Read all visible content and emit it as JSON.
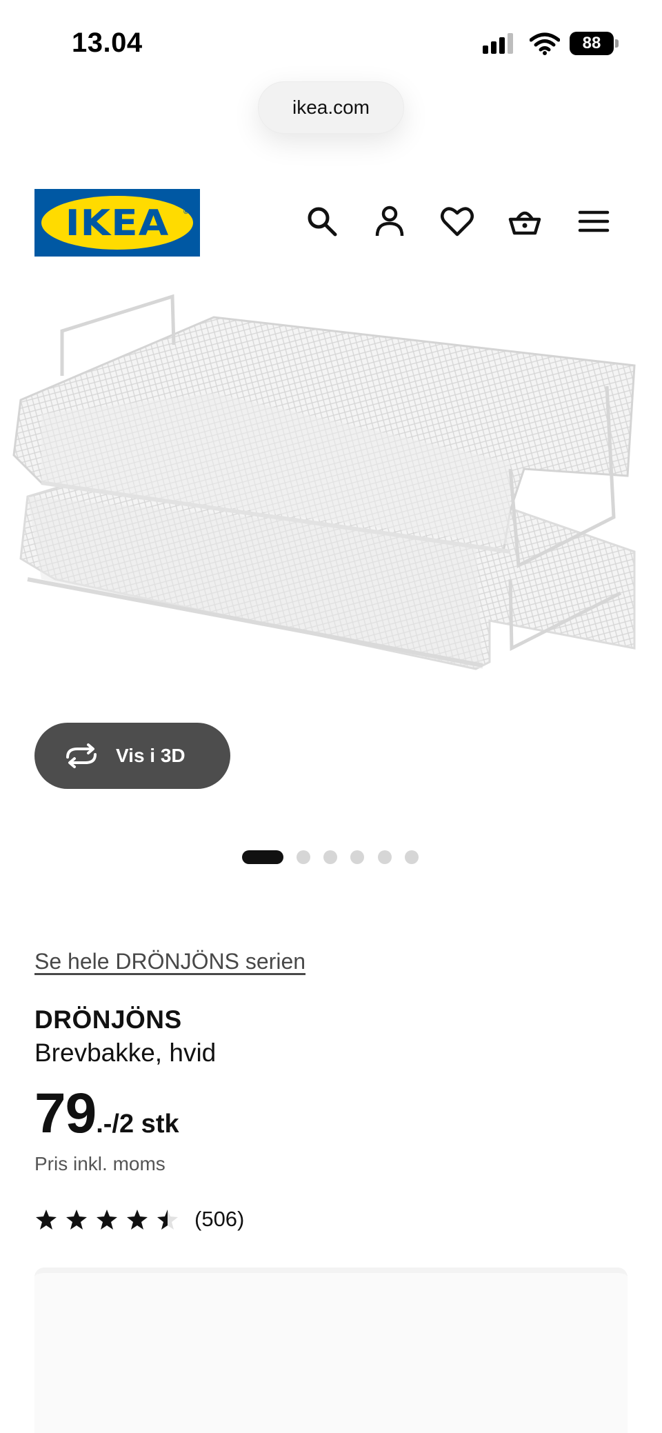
{
  "status_bar": {
    "time": "13.04",
    "battery": "88"
  },
  "browser": {
    "url": "ikea.com"
  },
  "header": {
    "logo_text": "IKEA",
    "icons": [
      "search-icon",
      "account-icon",
      "heart-icon",
      "basket-icon",
      "menu-icon"
    ]
  },
  "gallery": {
    "view_3d_label": "Vis i 3D",
    "page_count": 6,
    "active_page": 1
  },
  "product": {
    "series_link": "Se hele DRÖNJÖNS serien",
    "name": "DRÖNJÖNS",
    "description": "Brevbakke, hvid",
    "price_main": "79",
    "price_suffix": ".-/2 stk",
    "vat_note": "Pris inkl. moms",
    "rating": 4.5,
    "reviews": "(506)"
  },
  "colors": {
    "ikea_blue": "#0058a3",
    "ikea_yellow": "#ffdb00",
    "button_gray": "#4d4d4d"
  }
}
